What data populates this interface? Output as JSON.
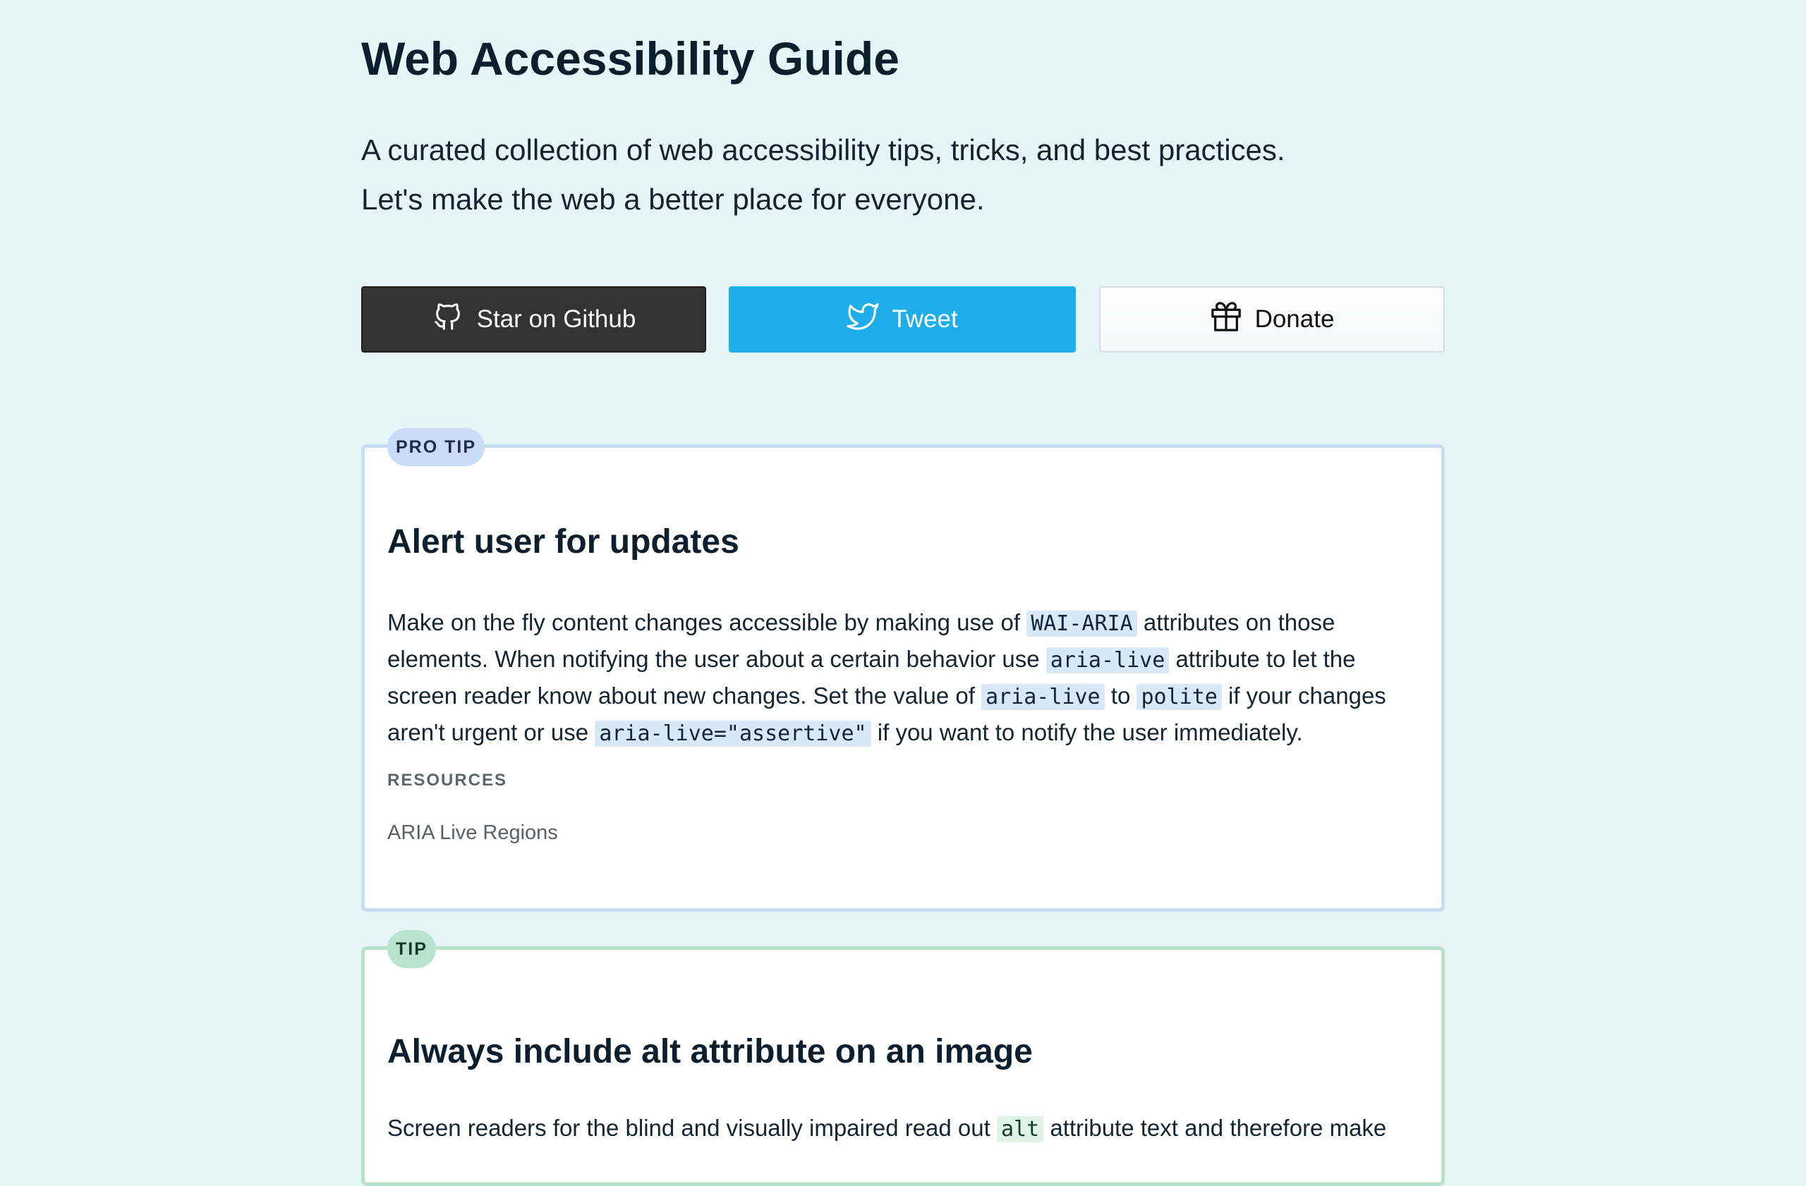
{
  "header": {
    "title": "Web Accessibility Guide",
    "intro_line1": "A curated collection of web accessibility tips, tricks, and best practices.",
    "intro_line2": "Let's make the web a better place for everyone."
  },
  "buttons": {
    "github": {
      "label": "Star on Github",
      "icon": "github-icon"
    },
    "tweet": {
      "label": "Tweet",
      "icon": "twitter-bird-icon"
    },
    "donate": {
      "label": "Donate",
      "icon": "gift-icon"
    }
  },
  "cards": [
    {
      "badge": "PRO TIP",
      "title": "Alert user for updates",
      "body": {
        "l1_a": "Make on the fly content changes accessible by making use of ",
        "l1_code": "WAI-ARIA",
        "l1_b": " attributes on those",
        "l2_a": "elements. When notifying the user about a certain behavior use ",
        "l2_code": "aria-live",
        "l2_b": " attribute to let the",
        "l3_a": "screen reader know about new changes. Set the value of ",
        "l3_code1": "aria-live",
        "l3_mid": " to ",
        "l3_code2": "polite",
        "l3_b": " if your changes",
        "l4_a": "aren't urgent or use ",
        "l4_code": "aria-live=\"assertive\"",
        "l4_b": " if you want to notify the user immediately."
      },
      "resources_label": "RESOURCES",
      "resources": [
        "ARIA Live Regions"
      ]
    },
    {
      "badge": "TIP",
      "title": "Always include alt attribute on an image",
      "body": {
        "l1_a": "Screen readers for the blind and visually impaired read out ",
        "l1_code": "alt",
        "l1_b": " attribute text and therefore make"
      }
    }
  ],
  "colors": {
    "page_background": "#e6f5f8",
    "github_button": "#333333",
    "tweet_button": "#1eaee9",
    "pro_tip_border": "#c8dcf4",
    "tip_border": "#b5e2cd"
  }
}
